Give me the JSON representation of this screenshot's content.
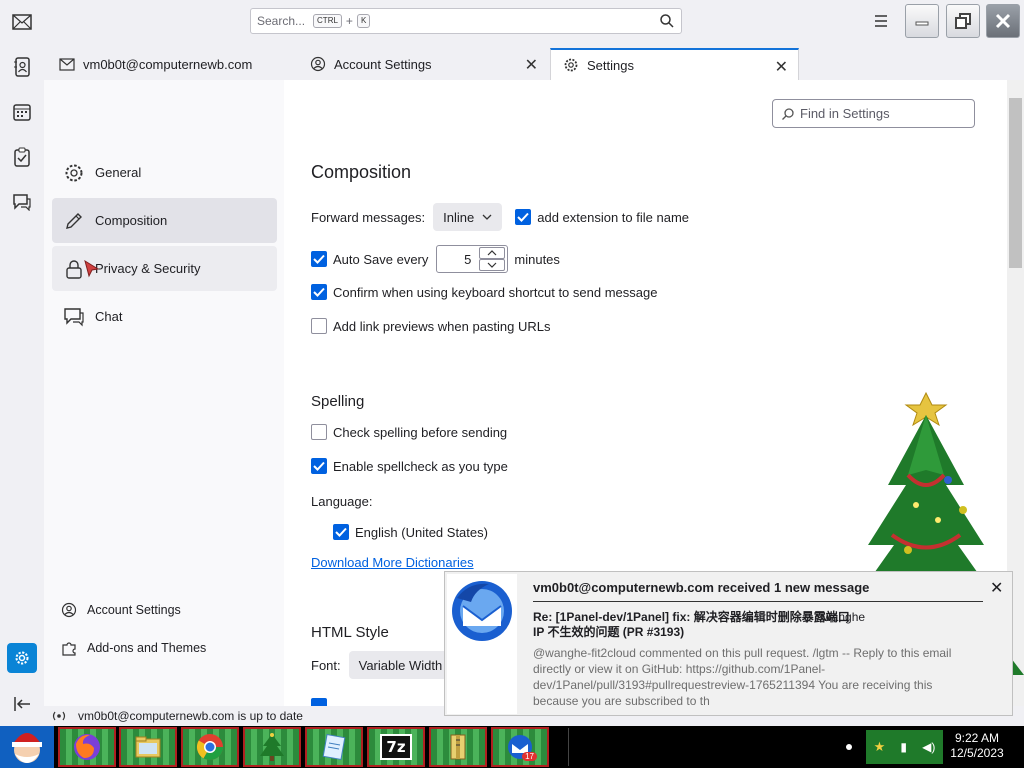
{
  "topbar": {
    "search_placeholder": "Search...",
    "kbd_ctrl": "CTRL",
    "kbd_plus": "+",
    "kbd_k": "K"
  },
  "tabs": [
    {
      "label": "vm0b0t@computernewb.com"
    },
    {
      "label": "Account Settings"
    },
    {
      "label": "Settings"
    }
  ],
  "find_placeholder": "Find in Settings",
  "categories": [
    {
      "label": "General"
    },
    {
      "label": "Composition"
    },
    {
      "label": "Privacy & Security"
    },
    {
      "label": "Chat"
    }
  ],
  "bottom_links": {
    "account_settings": "Account Settings",
    "addons": "Add-ons and Themes"
  },
  "composition": {
    "heading": "Composition",
    "forward_label": "Forward messages:",
    "forward_value": "Inline",
    "add_extension": "add extension to file name",
    "auto_save_label": "Auto Save every",
    "auto_save_value": "5",
    "minutes": "minutes",
    "confirm_shortcut": "Confirm when using keyboard shortcut to send message",
    "link_previews": "Add link previews when pasting URLs"
  },
  "spelling": {
    "heading": "Spelling",
    "check_before": "Check spelling before sending",
    "enable_as_type": "Enable spellcheck as you type",
    "language_label": "Language:",
    "language_en": "English (United States)",
    "download_link": "Download More Dictionaries"
  },
  "html_style": {
    "heading": "HTML Style",
    "font_label": "Font:",
    "font_value": "Variable Width"
  },
  "notification": {
    "title": "vm0b0t@computernewb.com received 1 new message",
    "subject": "Re: [1Panel-dev/1Panel] fix: 解决容器编辑时删除暴露端口 IP 不生效的问题 (PR #3193)",
    "sender": "wanghe",
    "body": "@wanghe-fit2cloud commented on this pull request. /lgtm -- Reply to this email directly or view it on GitHub: https://github.com/1Panel-dev/1Panel/pull/3193#pullrequestreview-1765211394 You are receiving this because you are subscribed to th"
  },
  "status_text": "vm0b0t@computernewb.com is up to date",
  "taskbar": {
    "time": "9:22 AM",
    "date": "12/5/2023",
    "badge": "17",
    "sevenzip": "7z"
  },
  "colors": {
    "accent": "#0061e0",
    "tab_accent": "#1373d9",
    "selected_category": "#e2e2e8"
  }
}
